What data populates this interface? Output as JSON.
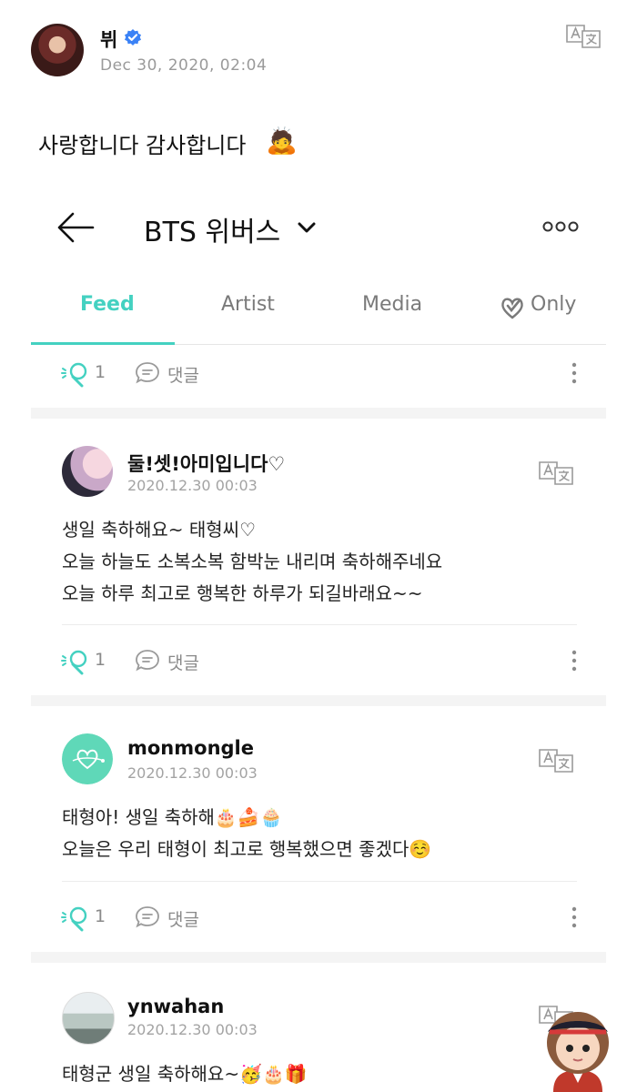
{
  "header_post": {
    "author": "뷔",
    "date": "Dec 30, 2020, 02:04",
    "text": "사랑합니다 감사합니다",
    "emoji": "🙇"
  },
  "nav": {
    "title": "BTS 위버스"
  },
  "tabs": [
    {
      "label": "Feed",
      "active": true
    },
    {
      "label": "Artist",
      "active": false
    },
    {
      "label": "Media",
      "active": false
    },
    {
      "label": "Only",
      "active": false
    }
  ],
  "actions": {
    "comment_label": "댓글"
  },
  "top_actions": {
    "cheer_count": "1"
  },
  "posts": [
    {
      "author": "둘!셋!아미입니다♡",
      "date": "2020.12.30 00:03",
      "lines": [
        "생일 축하해요~ 태형씨♡",
        "오늘 하늘도 소복소복 함박눈 내리며 축하해주네요",
        "오늘 하루 최고로 행복한 하루가 되길바래요~~"
      ],
      "cheer_count": "1"
    },
    {
      "author": "monmongle",
      "date": "2020.12.30 00:03",
      "lines": [
        "태형아! 생일 축하해🎂🍰🧁",
        "오늘은 우리 태형이 최고로 행복했으면 좋겠다☺️"
      ],
      "cheer_count": "1"
    },
    {
      "author": "ynwahan",
      "date": "2020.12.30 00:03",
      "lines": [
        "태형군 생일 축하해요~🥳🎂🎁"
      ]
    }
  ],
  "colors": {
    "accent": "#44d1c1",
    "verified": "#3b82f6"
  }
}
